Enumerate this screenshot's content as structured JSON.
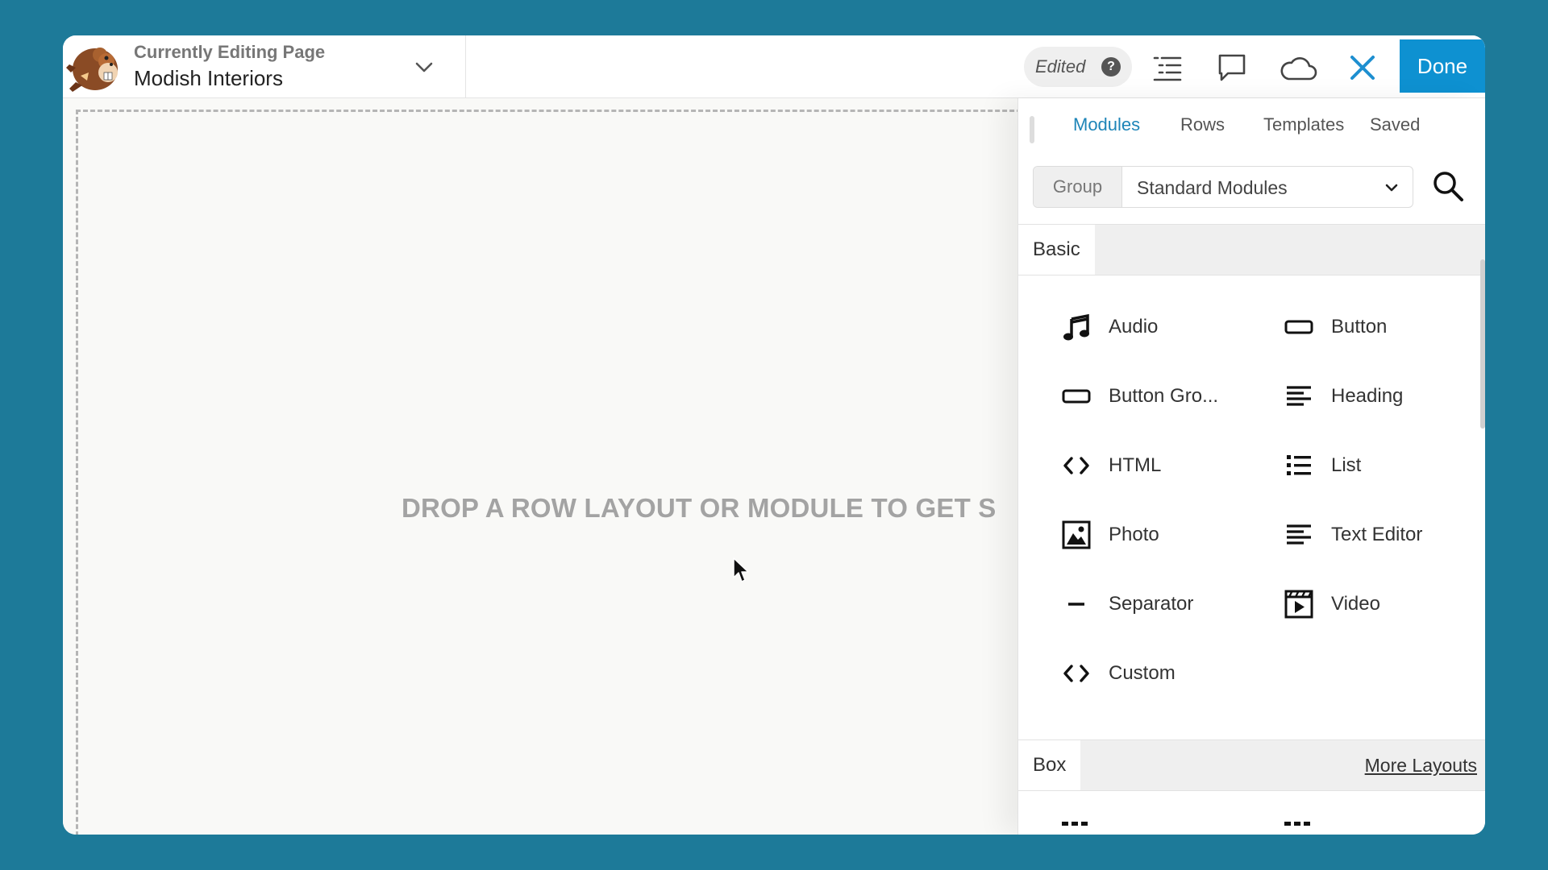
{
  "header": {
    "editing_label": "Currently Editing Page",
    "page_name": "Modish Interiors",
    "edited_label": "Edited",
    "help_glyph": "?",
    "done_label": "Done",
    "icons": [
      "outline-icon",
      "comment-icon",
      "cloud-icon",
      "close-icon"
    ]
  },
  "canvas": {
    "drop_text": "DROP A ROW LAYOUT OR MODULE TO GET S"
  },
  "panel": {
    "tabs": [
      {
        "label": "Modules",
        "active": true
      },
      {
        "label": "Rows",
        "active": false
      },
      {
        "label": "Templates",
        "active": false
      },
      {
        "label": "Saved",
        "active": false
      }
    ],
    "group": {
      "label": "Group",
      "value": "Standard Modules"
    },
    "sections": {
      "basic": "Basic",
      "box": "Box",
      "more_layouts": "More Layouts"
    },
    "modules": [
      {
        "label": "Audio",
        "icon": "music-note-icon"
      },
      {
        "label": "Button",
        "icon": "button-icon"
      },
      {
        "label": "Button Gro...",
        "icon": "button-group-icon"
      },
      {
        "label": "Heading",
        "icon": "heading-icon"
      },
      {
        "label": "HTML",
        "icon": "code-icon"
      },
      {
        "label": "List",
        "icon": "list-icon"
      },
      {
        "label": "Photo",
        "icon": "photo-icon"
      },
      {
        "label": "Text Editor",
        "icon": "text-editor-icon"
      },
      {
        "label": "Separator",
        "icon": "separator-icon"
      },
      {
        "label": "Video",
        "icon": "video-icon"
      },
      {
        "label": "Custom",
        "icon": "code-icon"
      }
    ]
  },
  "colors": {
    "background": "#1d7a99",
    "accent": "#0e91d1",
    "active_tab": "#1e85b8",
    "close_icon": "#1e8fd0"
  }
}
